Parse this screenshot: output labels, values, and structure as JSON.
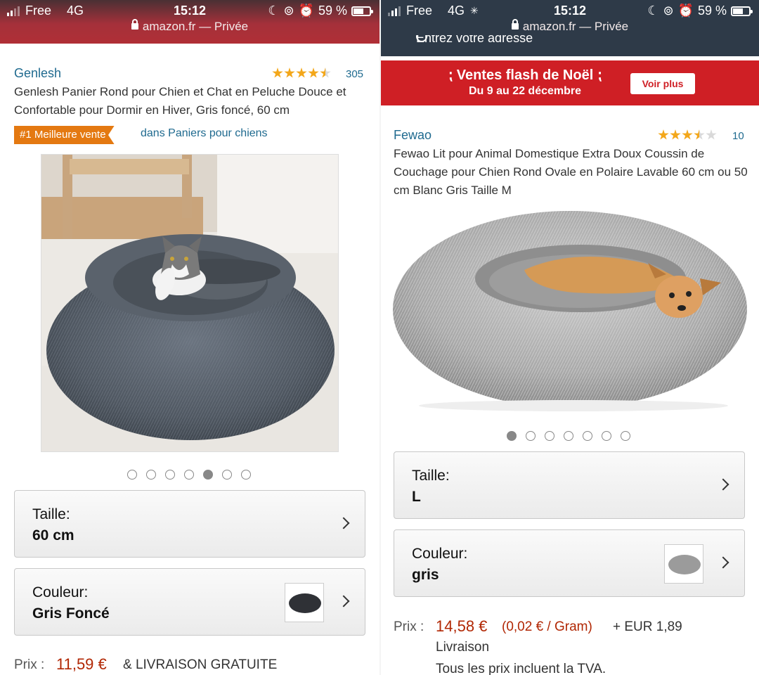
{
  "left": {
    "status": {
      "carrier": "Free",
      "network": "4G",
      "time": "15:12",
      "battery": "59 %"
    },
    "url": {
      "domain": "amazon.fr",
      "suffix": " — Privée"
    },
    "product": {
      "brand": "Genlesh",
      "rating": 4.5,
      "review_count": "305",
      "title": "Genlesh Panier Rond pour Chien et Chat en Peluche Douce et Confortable pour Dormir en Hiver, Gris foncé, 60 cm",
      "badge": "#1 Meilleure vente",
      "badge_category": "dans Paniers pour chiens",
      "image_icon": "cat-in-dark-grey-fluffy-bed",
      "carousel": {
        "count": 7,
        "active": 5
      },
      "size": {
        "label": "Taille:",
        "value": "60 cm"
      },
      "color": {
        "label": "Couleur:",
        "value": "Gris Foncé",
        "swatch_color": "#2f3136"
      },
      "price": {
        "label": "Prix :",
        "amount": "11,59 €",
        "shipping": "& LIVRAISON GRATUITE"
      }
    }
  },
  "right": {
    "status": {
      "carrier": "Free",
      "network": "4G",
      "time": "15:12",
      "battery": "59 %"
    },
    "url": {
      "domain": "amazon.fr",
      "suffix": " — Privée"
    },
    "address_text": "Entrez votre adresse",
    "promo": {
      "title": "Ventes flash de Noël",
      "subtitle": "Du 9 au 22 décembre",
      "button": "Voir plus"
    },
    "product": {
      "brand": "Fewao",
      "rating": 3.5,
      "review_count": "10",
      "title": "Fewao Lit pour Animal Domestique Extra Doux Coussin de Couchage pour Chien Rond Ovale en Polaire Lavable 60 cm ou 50 cm Blanc Gris Taille M",
      "image_icon": "dog-in-light-grey-fluffy-bed",
      "carousel": {
        "count": 7,
        "active": 1
      },
      "size": {
        "label": "Taille:",
        "value": "L"
      },
      "color": {
        "label": "Couleur:",
        "value": "gris",
        "swatch_color": "#9b9b9b"
      },
      "price": {
        "label": "Prix :",
        "amount": "14,58 €",
        "unit_price": "(0,02 € / Gram)",
        "shipping": "+ EUR 1,89",
        "shipping_note": "Livraison",
        "tax_note": "Tous les prix incluent la TVA."
      }
    }
  },
  "colors": {
    "amazon_orange": "#e47911",
    "link_blue": "#1f6a8f",
    "price_red": "#b12704",
    "promo_red": "#cf1f25",
    "star": "#f3a71a"
  }
}
